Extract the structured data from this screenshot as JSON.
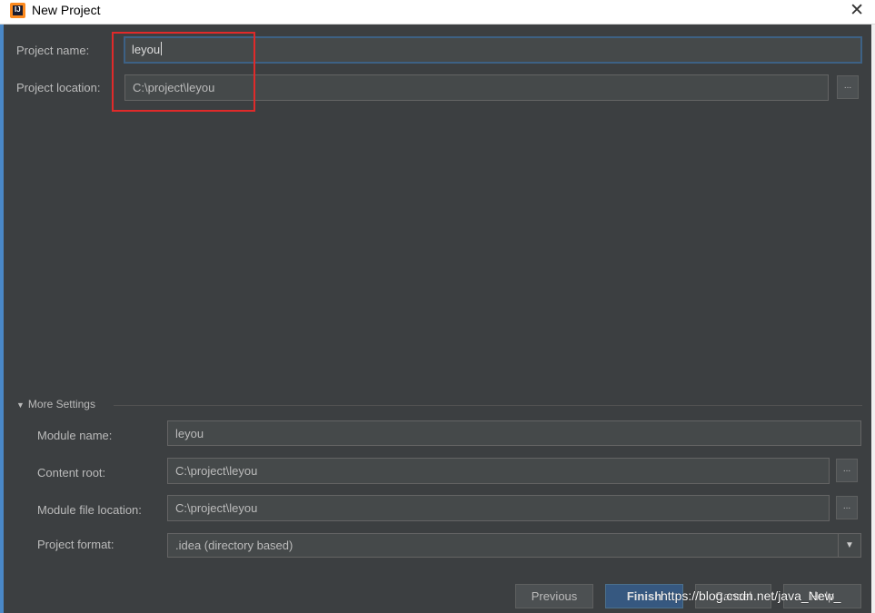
{
  "window": {
    "title": "New Project",
    "close_glyph": "✕",
    "app_icon": "intellij-idea-icon"
  },
  "project_name": {
    "label": "Project name:",
    "value": "leyou"
  },
  "project_location": {
    "label": "Project location:",
    "value": "C:\\project\\leyou",
    "browse_label": "..."
  },
  "more_settings": {
    "label": "More Settings",
    "expanded": true
  },
  "module_name": {
    "label": "Module name:",
    "value": "leyou"
  },
  "content_root": {
    "label": "Content root:",
    "value": "C:\\project\\leyou",
    "browse_label": "..."
  },
  "module_file_location": {
    "label": "Module file location:",
    "value": "C:\\project\\leyou",
    "browse_label": "..."
  },
  "project_format": {
    "label": "Project format:",
    "selected": ".idea (directory based)"
  },
  "buttons": {
    "previous": "Previous",
    "finish": "Finish",
    "cancel": "Cancel",
    "help": "Help"
  },
  "watermark": "https://blog.csdn.net/java_New_",
  "colors": {
    "background": "#3c3f41",
    "field": "#45494a",
    "highlight": "#e02a2a",
    "accent": "#4a88c7",
    "primary_button": "#365880"
  }
}
